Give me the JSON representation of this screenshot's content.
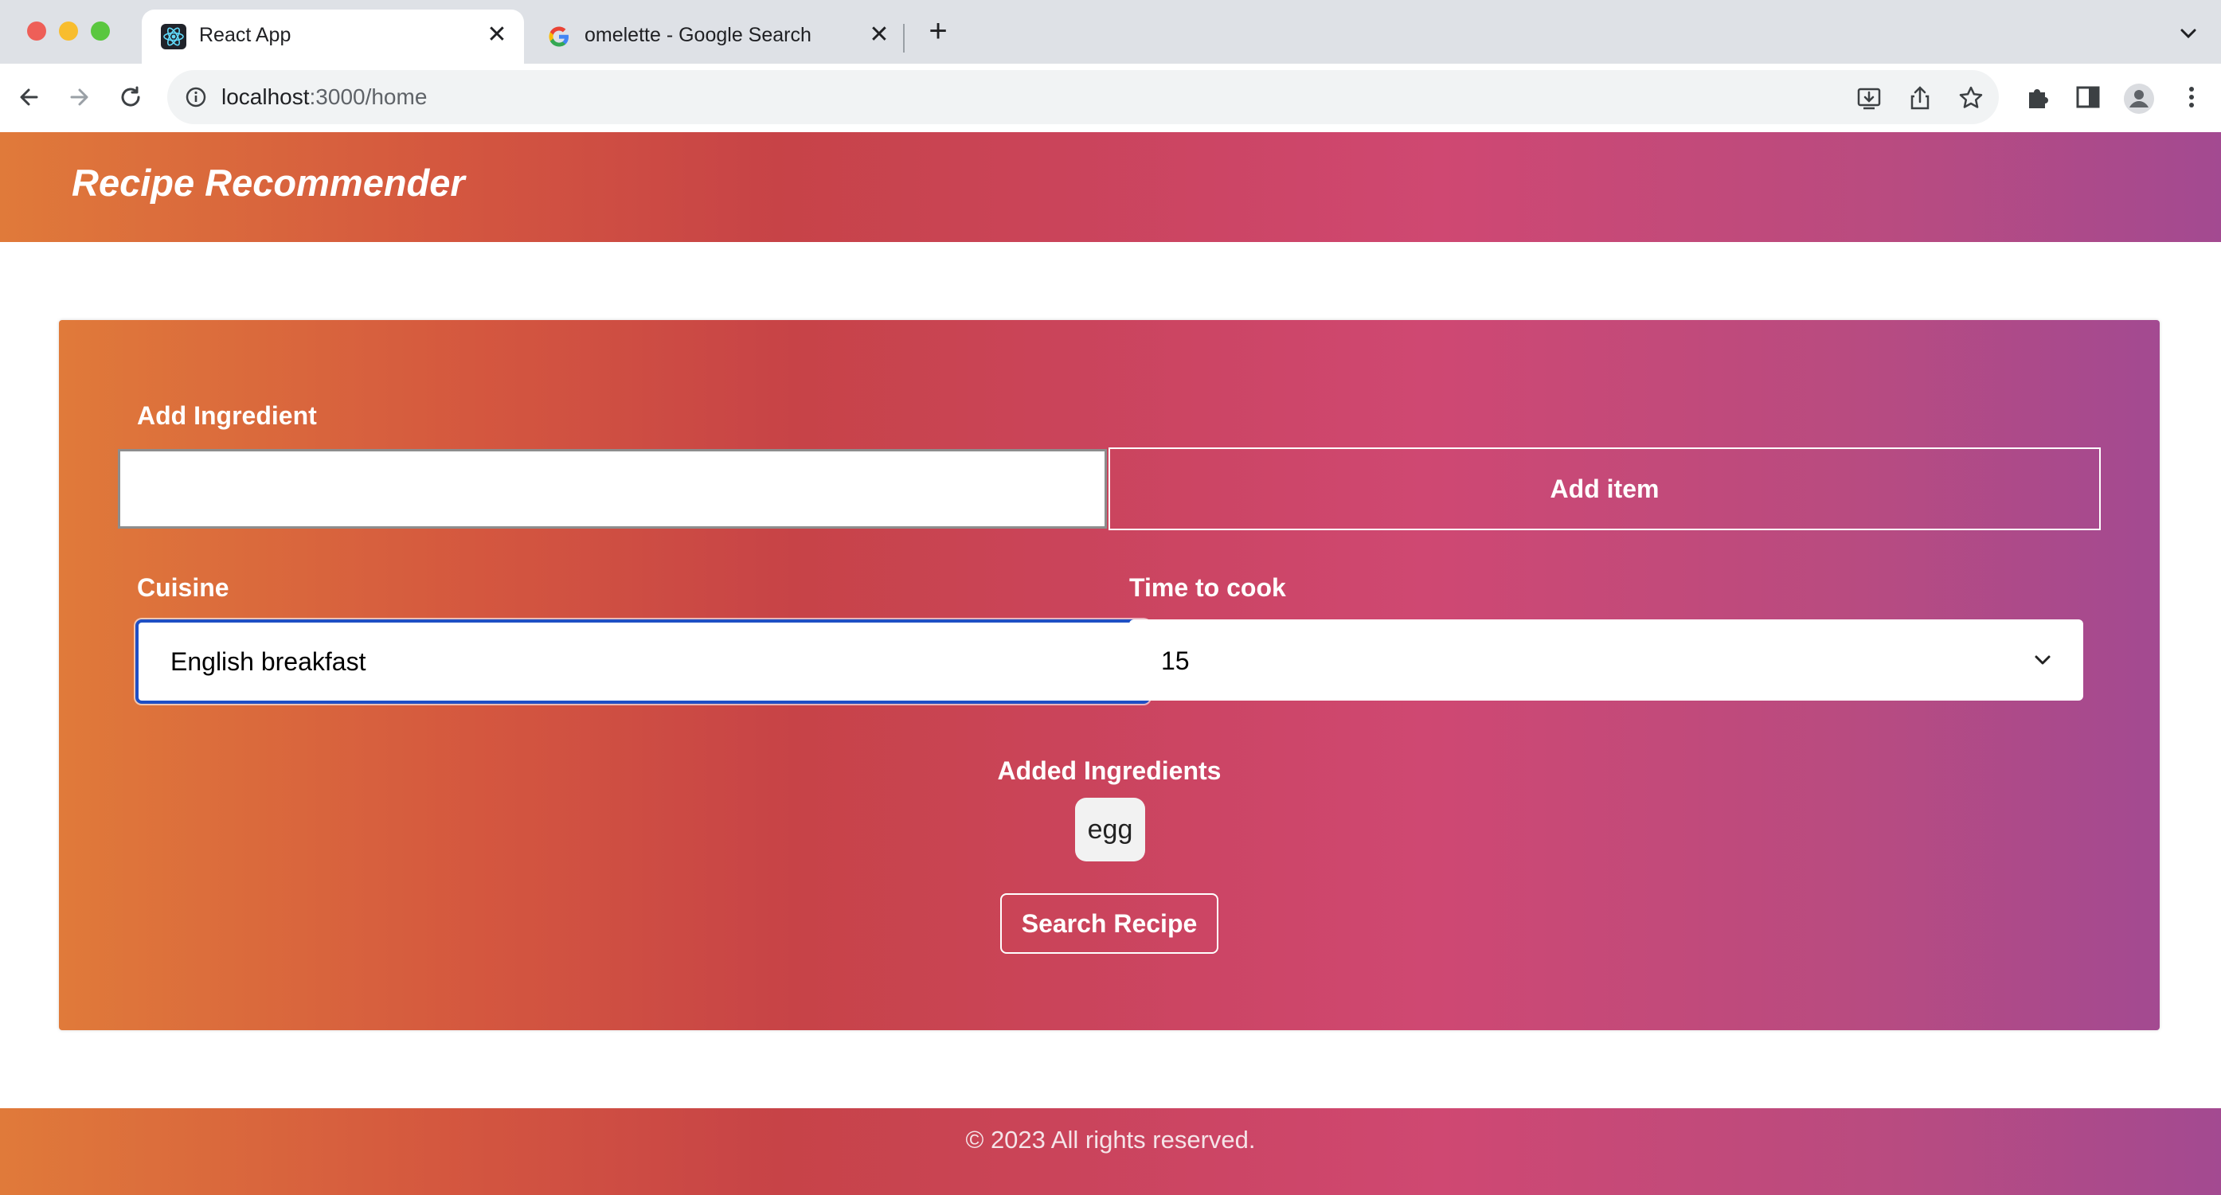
{
  "browser": {
    "tabs": [
      {
        "title": "React App",
        "icon": "react-icon",
        "active": true
      },
      {
        "title": "omelette - Google Search",
        "icon": "google-icon",
        "active": false
      }
    ],
    "close_glyph": "✕",
    "new_tab_glyph": "+",
    "url": {
      "host": "localhost",
      "rest": ":3000/home"
    }
  },
  "app": {
    "title": "Recipe Recommender"
  },
  "form": {
    "ingredient_label": "Add Ingredient",
    "ingredient_value": "",
    "add_item_label": "Add item",
    "cuisine_label": "Cuisine",
    "cuisine_value": "English breakfast",
    "time_label": "Time to cook",
    "time_value": "15",
    "added_title": "Added Ingredients",
    "added_ingredients": [
      "egg"
    ],
    "search_label": "Search Recipe"
  },
  "footer": {
    "text": "© 2023 All rights reserved."
  },
  "colors": {
    "gradient_start": "#e07a3a",
    "gradient_mid": "#c74347",
    "gradient_pink": "#cf4872",
    "gradient_end": "#a34a91",
    "focus_border": "#1f4fc4"
  }
}
